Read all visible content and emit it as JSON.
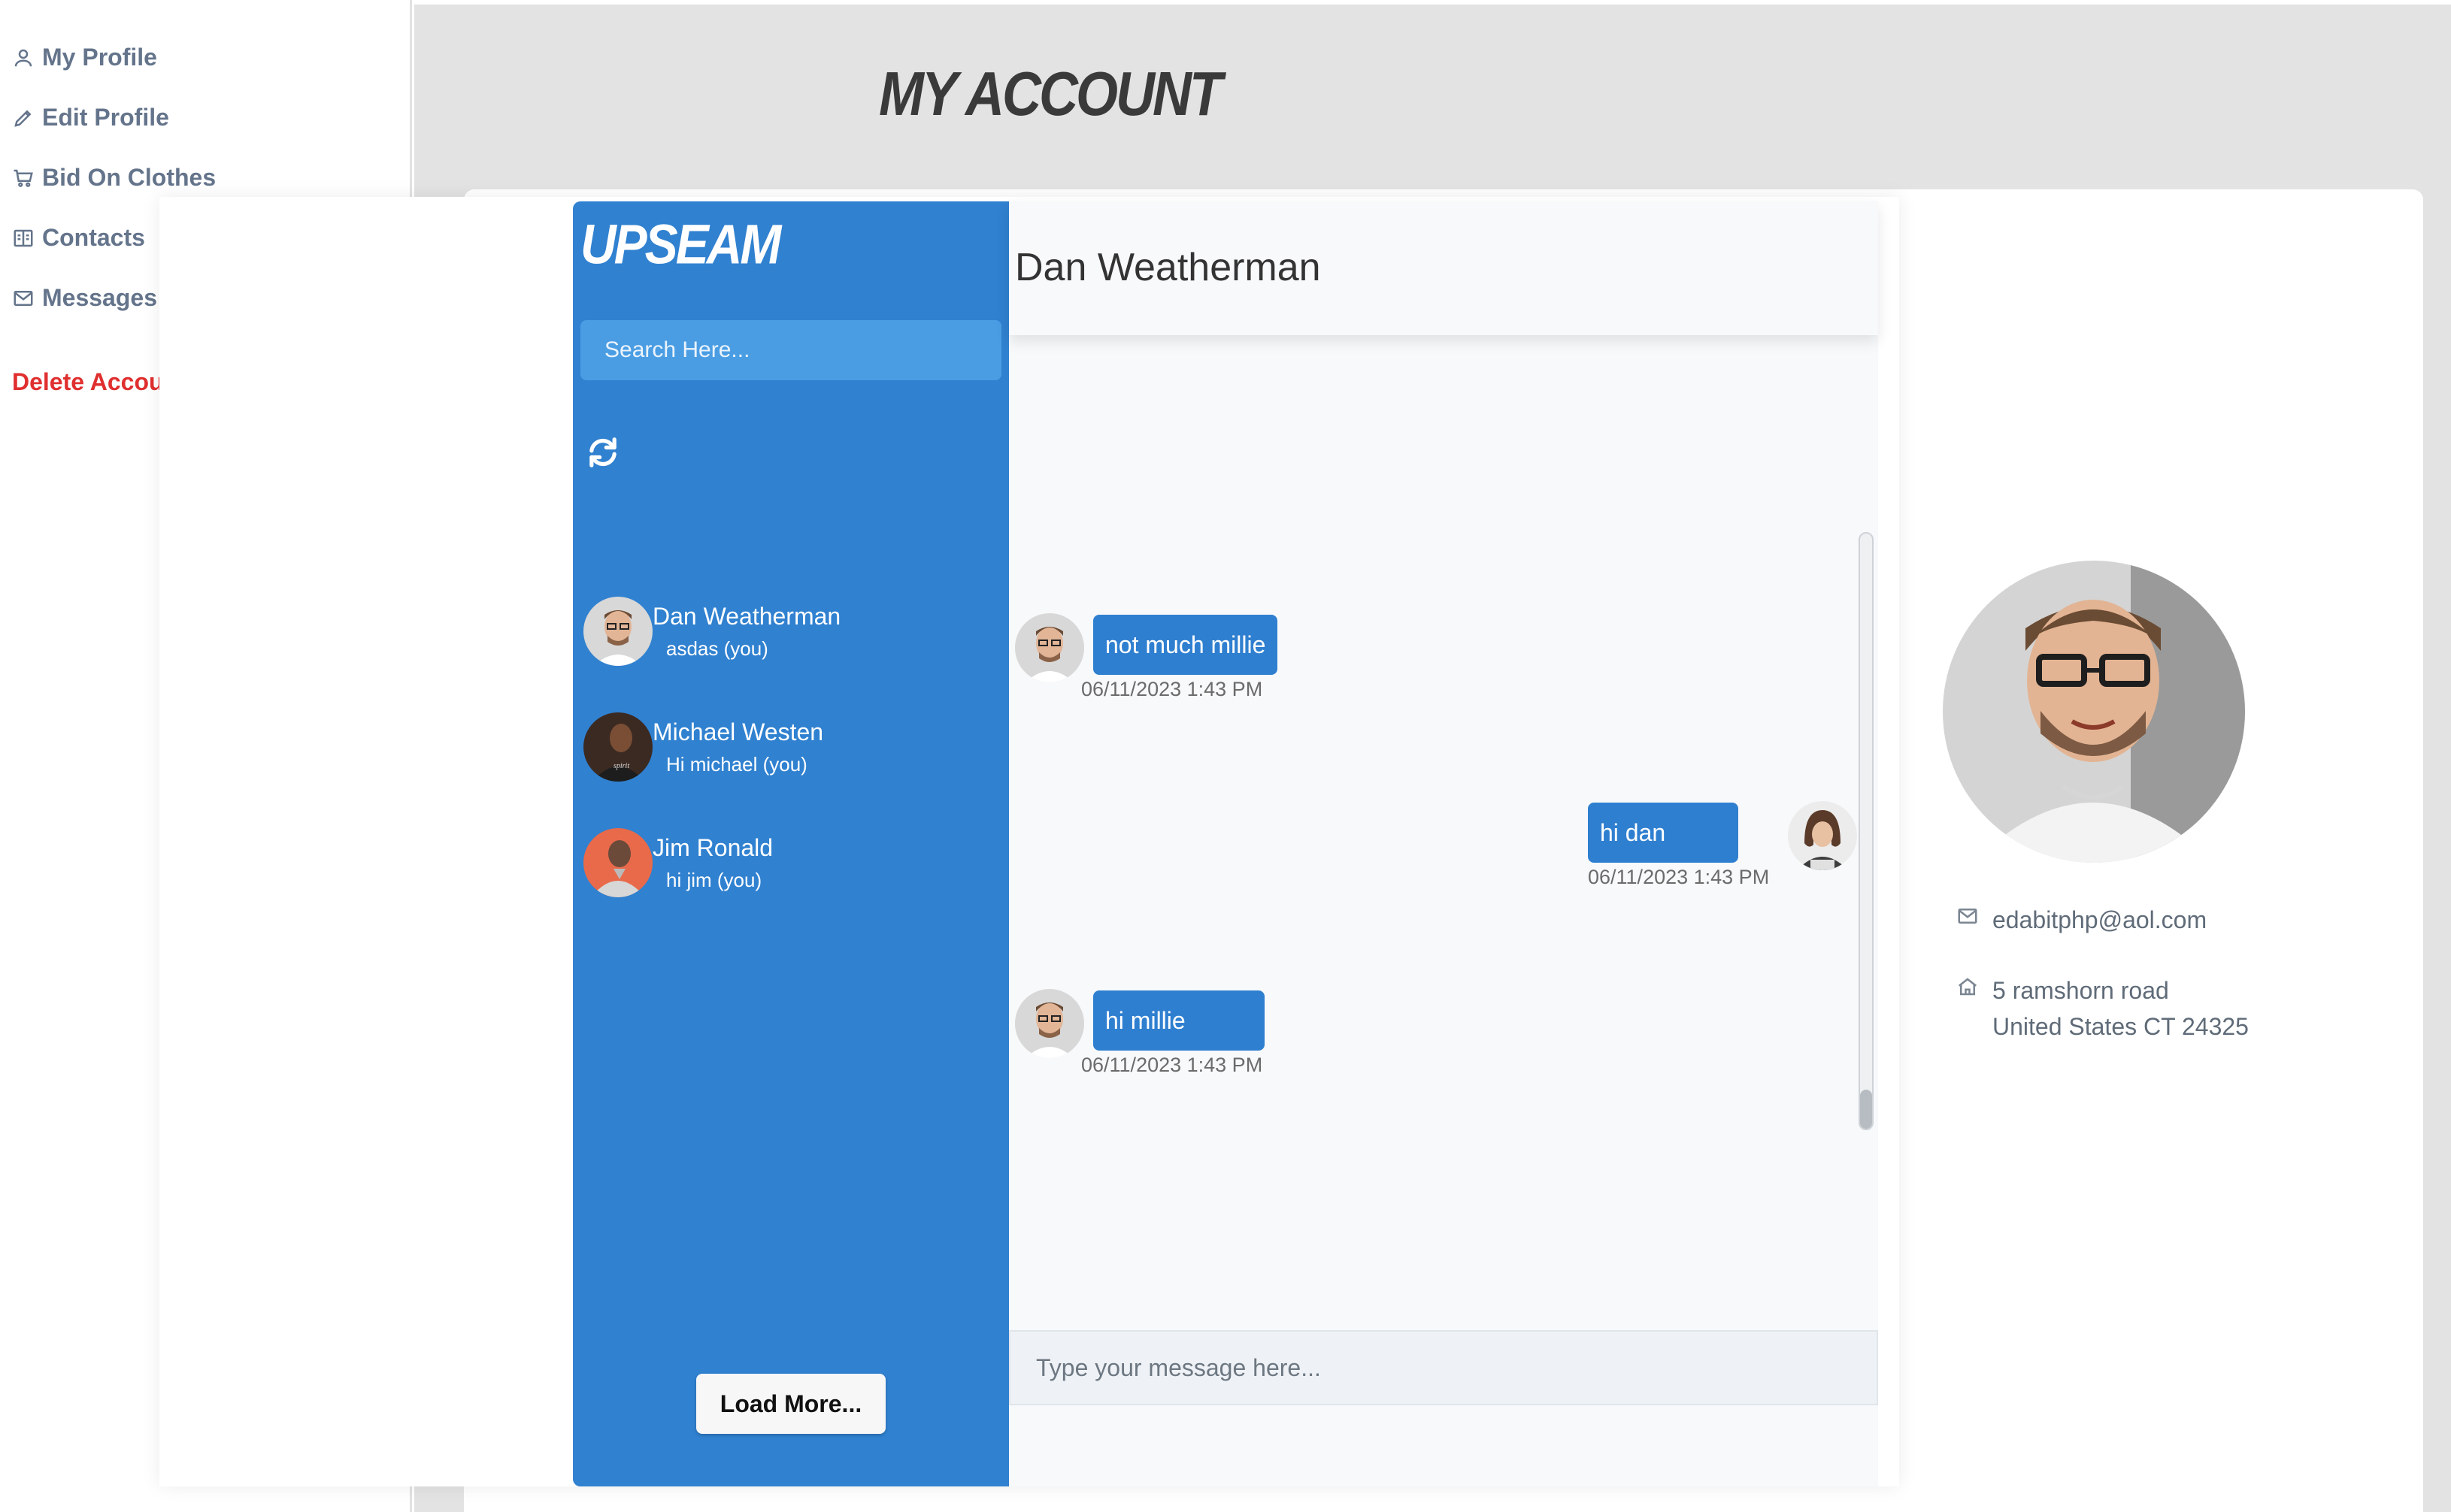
{
  "sidebar": {
    "items": [
      {
        "label": "My Profile",
        "icon": "user-icon"
      },
      {
        "label": "Edit Profile",
        "icon": "pencil-icon"
      },
      {
        "label": "Bid On Clothes",
        "icon": "cart-icon"
      },
      {
        "label": "Contacts",
        "icon": "address-book-icon"
      },
      {
        "label": "Messages",
        "icon": "envelope-icon"
      }
    ],
    "delete_label": "Delete Account"
  },
  "page": {
    "title": "MY ACCOUNT"
  },
  "chat": {
    "brand": "UPSEAM",
    "search_placeholder": "Search Here...",
    "contacts": [
      {
        "name": "Dan Weatherman",
        "last_message": "asdas (you)"
      },
      {
        "name": "Michael Westen",
        "last_message": "Hi michael (you)"
      },
      {
        "name": "Jim Ronald",
        "last_message": "hi jim (you)"
      }
    ],
    "load_more_label": "Load More...",
    "active_contact": "Dan Weatherman",
    "messages": [
      {
        "text": "not much millie",
        "time": "06/11/2023 1:43 PM",
        "from": "contact"
      },
      {
        "text": "hi dan",
        "time": "06/11/2023 1:43 PM",
        "from": "me"
      },
      {
        "text": "hi millie",
        "time": "06/11/2023 1:43 PM",
        "from": "contact"
      }
    ],
    "input_placeholder": "Type your message here..."
  },
  "profile": {
    "email": "edabitphp@aol.com",
    "address_line1": "5 ramshorn road",
    "address_line2": "United States CT 24325"
  },
  "colors": {
    "accent_blue": "#3081d0",
    "bubble_blue": "#2f7fd0",
    "danger": "#e02f2f",
    "sidebar_text": "#64748b"
  }
}
